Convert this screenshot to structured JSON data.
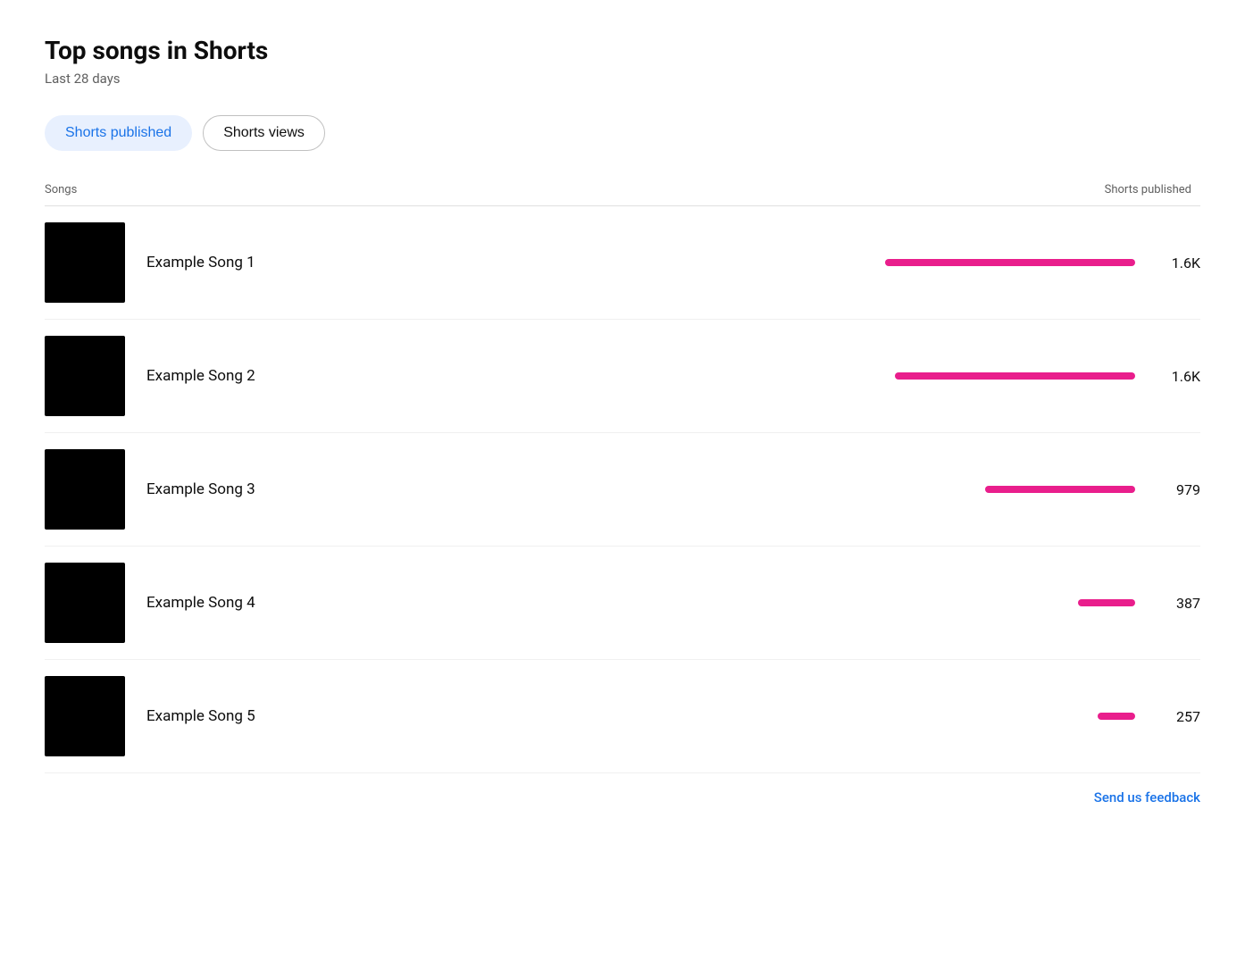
{
  "page": {
    "title": "Top songs in Shorts",
    "subtitle": "Last 28 days"
  },
  "filters": [
    {
      "id": "shorts-published",
      "label": "Shorts published",
      "active": true
    },
    {
      "id": "shorts-views",
      "label": "Shorts views",
      "active": false
    }
  ],
  "table": {
    "col_songs": "Songs",
    "col_metric": "Shorts published"
  },
  "songs": [
    {
      "name": "Example Song 1",
      "value": "1.6K",
      "bar_pct": 100
    },
    {
      "name": "Example Song 2",
      "value": "1.6K",
      "bar_pct": 96
    },
    {
      "name": "Example Song 3",
      "value": "979",
      "bar_pct": 60
    },
    {
      "name": "Example Song 4",
      "value": "387",
      "bar_pct": 23
    },
    {
      "name": "Example Song 5",
      "value": "257",
      "bar_pct": 15
    }
  ],
  "feedback": {
    "label": "Send us feedback"
  },
  "colors": {
    "bar": "#e91e8c",
    "active_filter_bg": "#e8f0fe",
    "active_filter_text": "#1a73e8"
  }
}
